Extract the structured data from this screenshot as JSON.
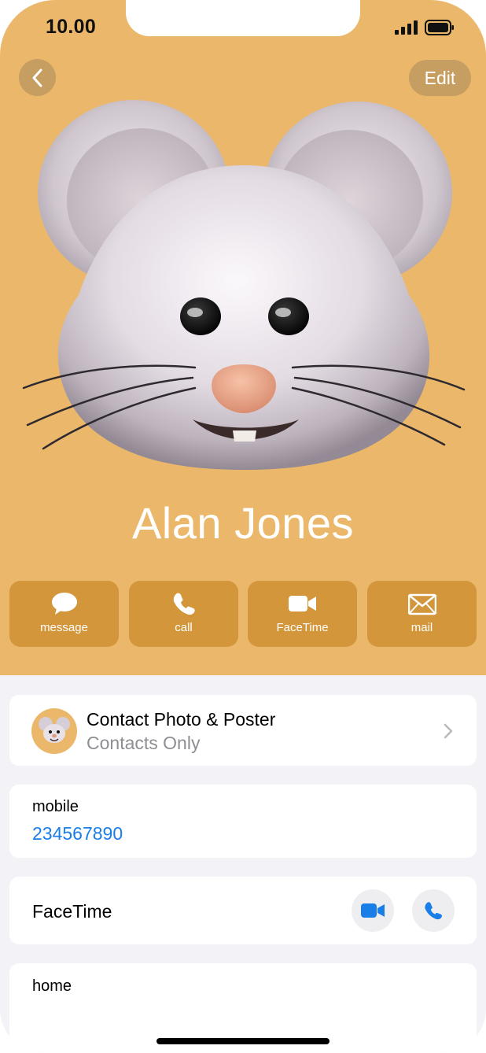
{
  "status": {
    "time": "10.00"
  },
  "header": {
    "edit_label": "Edit"
  },
  "contact": {
    "name": "Alan Jones"
  },
  "actions": [
    {
      "label": "message",
      "icon": "message-bubble-icon"
    },
    {
      "label": "call",
      "icon": "phone-icon"
    },
    {
      "label": "FaceTime",
      "icon": "video-camera-icon"
    },
    {
      "label": "mail",
      "icon": "envelope-icon"
    }
  ],
  "poster": {
    "title": "Contact Photo & Poster",
    "subtitle": "Contacts Only"
  },
  "phone": {
    "label": "mobile",
    "number": "234567890"
  },
  "facetime": {
    "label": "FaceTime"
  },
  "address": {
    "label": "home"
  },
  "colors": {
    "hero": "#ebb86b",
    "action": "#d4963a",
    "link": "#1a7ee8"
  }
}
